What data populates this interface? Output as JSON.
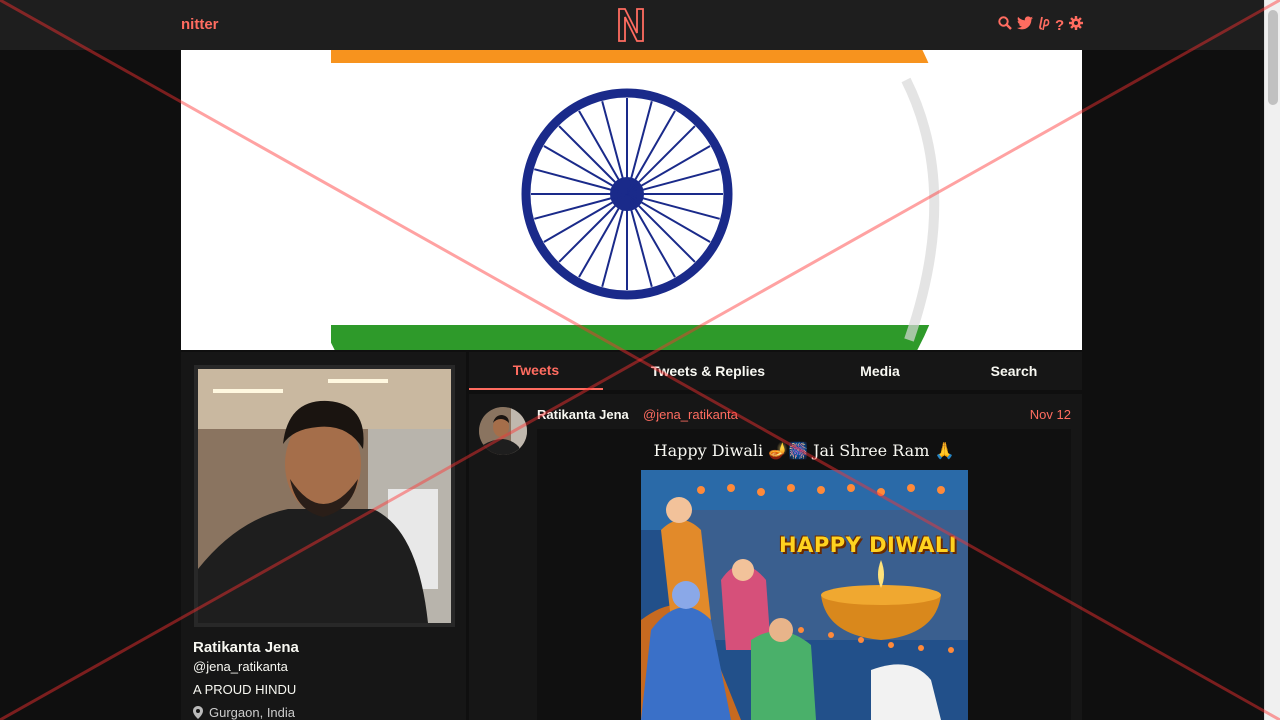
{
  "nav": {
    "brand": "nitter",
    "logo_letter": "N",
    "icons": [
      "search-icon",
      "twitter-icon",
      "liberapay-icon",
      "help-icon",
      "gear-icon"
    ]
  },
  "colors": {
    "accent": "#ff6c60",
    "background": "#0f0f0f",
    "panel": "#161616",
    "navbar": "#1e1e1e"
  },
  "profile": {
    "fullname": "Ratikanta Jena",
    "username": "@jena_ratikanta",
    "bio": "A PROUD HINDU",
    "location": "Gurgaon, India"
  },
  "tabs": [
    {
      "label": "Tweets",
      "active": true
    },
    {
      "label": "Tweets & Replies",
      "active": false
    },
    {
      "label": "Media",
      "active": false
    },
    {
      "label": "Search",
      "active": false
    }
  ],
  "tweet": {
    "fullname": "Ratikanta Jena",
    "username": "@jena_ratikanta",
    "date": "Nov 12",
    "media_caption": "Happy Diwali 🪔🎆 Jai Shree Ram 🙏",
    "media_text": "HAPPY DIWALI"
  }
}
